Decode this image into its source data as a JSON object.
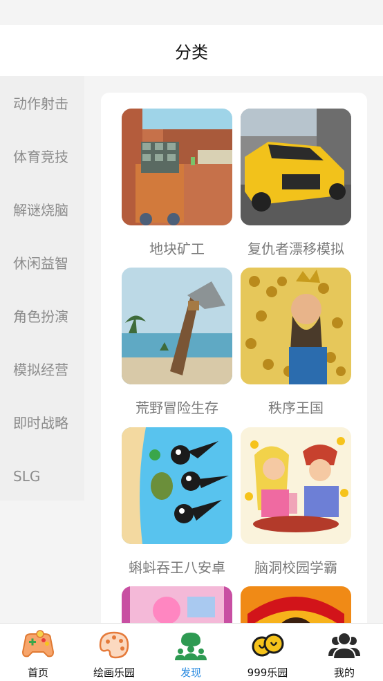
{
  "header": {
    "title": "分类"
  },
  "sidebar": {
    "items": [
      {
        "label": "动作射击"
      },
      {
        "label": "体育竞技"
      },
      {
        "label": "解谜烧脑"
      },
      {
        "label": "休闲益智"
      },
      {
        "label": "角色扮演"
      },
      {
        "label": "模拟经营"
      },
      {
        "label": "即时战略"
      },
      {
        "label": "SLG"
      }
    ]
  },
  "games": [
    {
      "name": "地块矿工"
    },
    {
      "name": "复仇者漂移模拟"
    },
    {
      "name": "荒野冒险生存"
    },
    {
      "name": "秩序王国"
    },
    {
      "name": "蝌蚪吞王八安卓"
    },
    {
      "name": "脑洞校园学霸"
    }
  ],
  "tabbar": {
    "items": [
      {
        "label": "首页",
        "icon": "gamepad-icon"
      },
      {
        "label": "绘画乐园",
        "icon": "palette-icon"
      },
      {
        "label": "发现",
        "icon": "discover-group-icon",
        "active": true
      },
      {
        "label": "999乐园",
        "icon": "coins-icon"
      },
      {
        "label": "我的",
        "icon": "users-icon"
      }
    ]
  },
  "colors": {
    "accent": "#2a8be0",
    "text_muted": "#8b8b8b",
    "tab_active_icon": "#2e9a52"
  }
}
